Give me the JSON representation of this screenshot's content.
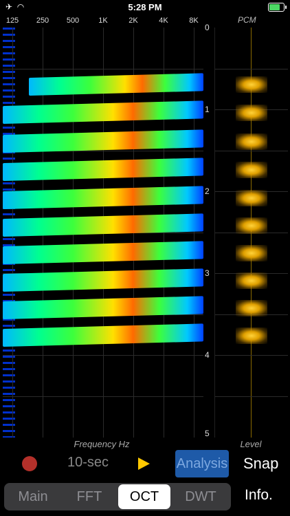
{
  "status": {
    "time": "5:28 PM"
  },
  "spectrogram": {
    "frequency_ticks": [
      "125",
      "250",
      "500",
      "1K",
      "2K",
      "4K",
      "8K"
    ],
    "time_ticks": [
      "0",
      "1",
      "2",
      "3",
      "4",
      "5"
    ],
    "xlabel": "Frequency Hz"
  },
  "pcm": {
    "title": "PCM",
    "ylabel": "Level"
  },
  "controls": {
    "duration_label": "10-sec",
    "analysis_label": "Analysis",
    "snap_label": "Snap"
  },
  "tabs": [
    {
      "label": "Main",
      "active": false
    },
    {
      "label": "FFT",
      "active": false
    },
    {
      "label": "OCT",
      "active": true
    },
    {
      "label": "DWT",
      "active": false
    }
  ],
  "info_label": "Info.",
  "colors": {
    "record": "#b3302a",
    "play": "#ffc800",
    "analysis_bg": "#1e5aa8",
    "pcm_burst": "#ffd23a"
  }
}
